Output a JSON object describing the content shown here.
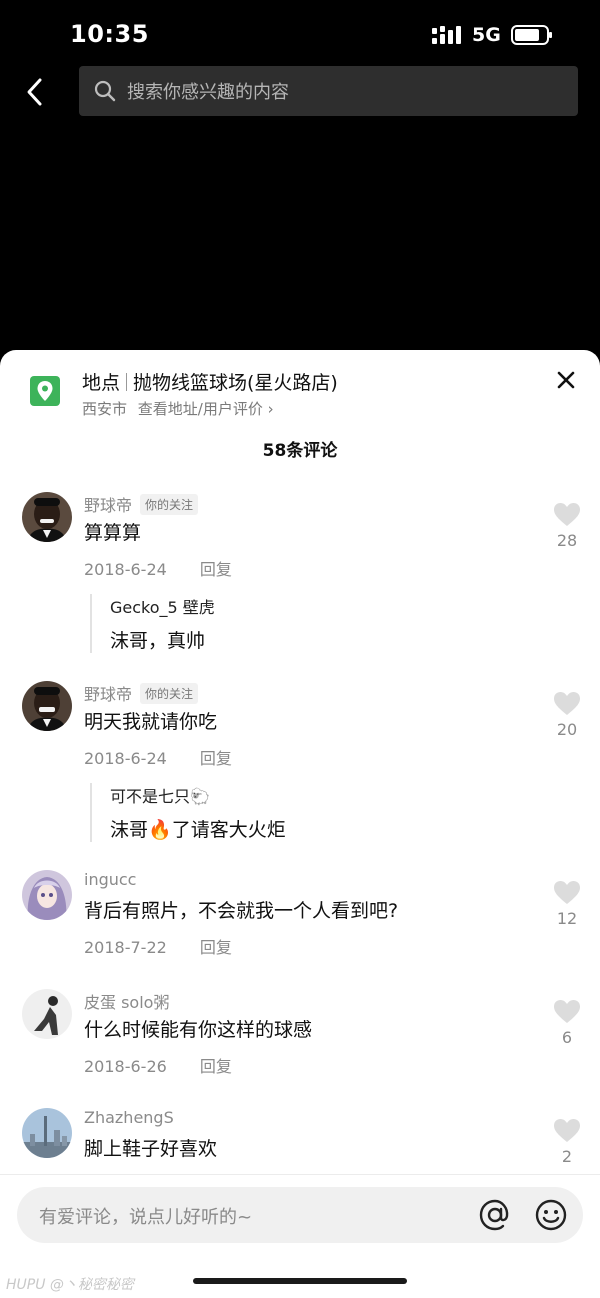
{
  "status_bar": {
    "time": "10:35",
    "network": "5G"
  },
  "search": {
    "placeholder": "搜索你感兴趣的内容"
  },
  "location": {
    "label": "地点",
    "name": "抛物线篮球场(星火路店)",
    "city": "西安市",
    "link": "查看地址/用户评价 ›"
  },
  "comment_count": "58条评论",
  "comments": [
    {
      "name": "野球帝",
      "tag": "你的关注",
      "text": "算算算",
      "date": "2018-6-24",
      "reply_label": "回复",
      "likes": "28",
      "reply": {
        "author": "Gecko_5 壁虎",
        "text": "沫哥，真帅"
      }
    },
    {
      "name": "野球帝",
      "tag": "你的关注",
      "text": "明天我就请你吃",
      "date": "2018-6-24",
      "reply_label": "回复",
      "likes": "20",
      "reply": {
        "author": "可不是七只",
        "author_emoji": "🐑",
        "text_a": "沫哥",
        "text_emoji": "🔥",
        "text_b": "了请客大火炬"
      }
    },
    {
      "name": "ingucc",
      "text": "背后有照片，不会就我一个人看到吧?",
      "date": "2018-7-22",
      "reply_label": "回复",
      "likes": "12"
    },
    {
      "name": "皮蛋 solo粥",
      "text": "什么时候能有你这样的球感",
      "date": "2018-6-26",
      "reply_label": "回复",
      "likes": "6"
    },
    {
      "name": "ZhazhengS",
      "text": "脚上鞋子好喜欢",
      "likes": "2"
    }
  ],
  "input": {
    "placeholder": "有爱评论，说点儿好听的~"
  },
  "watermark": "HUPU @丶秘密秘密",
  "colors": {
    "accent_green": "#3db35a",
    "sheet_bg": "#ffffff",
    "top_bg": "#000000"
  },
  "icons": [
    "back-arrow-icon",
    "search-icon",
    "location-pin-icon",
    "close-icon",
    "heart-icon",
    "at-icon",
    "emoji-icon"
  ]
}
